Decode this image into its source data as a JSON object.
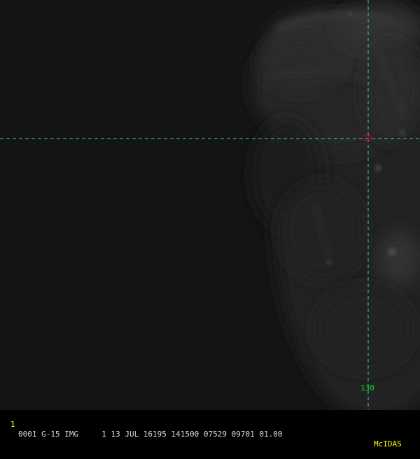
{
  "image": {
    "subject": "satellite-image",
    "latitude_label": "20",
    "longitude_label": "130"
  },
  "status_bar": {
    "frame_number": "1",
    "info": "0001 G-15 IMG     1 13 JUL 16195 141500 07529 09701 01.00",
    "brand": "McIDAS"
  },
  "colors": {
    "gridline": "#35c8d8",
    "latitude_label": "#c00000",
    "longitude_label": "#20d020",
    "status_highlight": "#ffff00",
    "status_text": "#d8d8d8",
    "background": "#141414"
  }
}
